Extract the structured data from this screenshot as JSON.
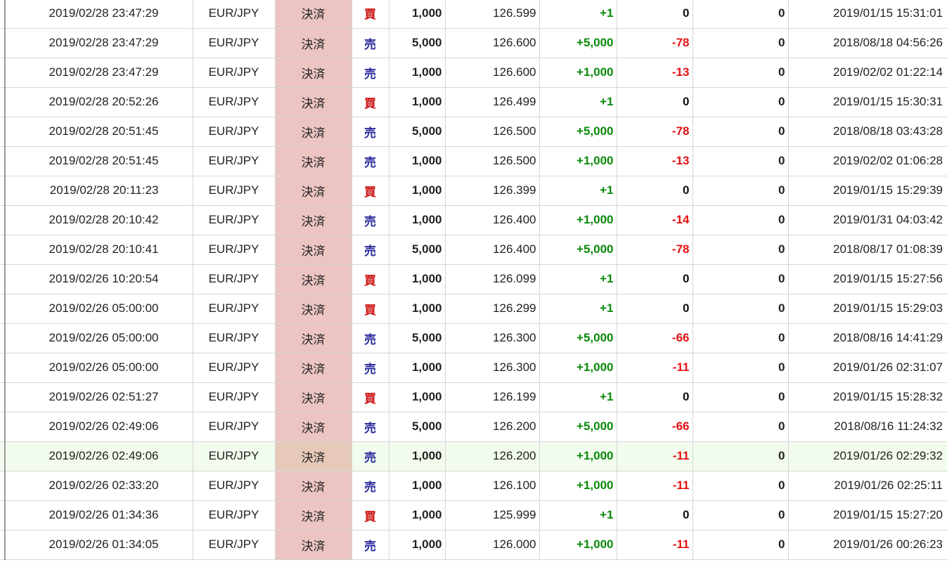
{
  "colors": {
    "buy": "#cc1111",
    "sell": "#2b2b9c",
    "positive": "#0a8a0a",
    "negative": "#e31010",
    "neutral": "#111111",
    "type_bg": "#ecc5c3",
    "highlight_row": "#f1fbee"
  },
  "rows": [
    {
      "time": "2019/02/28 23:47:29",
      "pair": "EUR/JPY",
      "type": "決済",
      "side": "買",
      "side_key": "buy",
      "qty": "1,000",
      "price": "126.599",
      "pnl": "+1",
      "swap": "0",
      "fee": "0",
      "open_time": "2019/01/15 15:31:01"
    },
    {
      "time": "2019/02/28 23:47:29",
      "pair": "EUR/JPY",
      "type": "決済",
      "side": "売",
      "side_key": "sell",
      "qty": "5,000",
      "price": "126.600",
      "pnl": "+5,000",
      "swap": "-78",
      "fee": "0",
      "open_time": "2018/08/18 04:56:26"
    },
    {
      "time": "2019/02/28 23:47:29",
      "pair": "EUR/JPY",
      "type": "決済",
      "side": "売",
      "side_key": "sell",
      "qty": "1,000",
      "price": "126.600",
      "pnl": "+1,000",
      "swap": "-13",
      "fee": "0",
      "open_time": "2019/02/02 01:22:14"
    },
    {
      "time": "2019/02/28 20:52:26",
      "pair": "EUR/JPY",
      "type": "決済",
      "side": "買",
      "side_key": "buy",
      "qty": "1,000",
      "price": "126.499",
      "pnl": "+1",
      "swap": "0",
      "fee": "0",
      "open_time": "2019/01/15 15:30:31"
    },
    {
      "time": "2019/02/28 20:51:45",
      "pair": "EUR/JPY",
      "type": "決済",
      "side": "売",
      "side_key": "sell",
      "qty": "5,000",
      "price": "126.500",
      "pnl": "+5,000",
      "swap": "-78",
      "fee": "0",
      "open_time": "2018/08/18 03:43:28"
    },
    {
      "time": "2019/02/28 20:51:45",
      "pair": "EUR/JPY",
      "type": "決済",
      "side": "売",
      "side_key": "sell",
      "qty": "1,000",
      "price": "126.500",
      "pnl": "+1,000",
      "swap": "-13",
      "fee": "0",
      "open_time": "2019/02/02 01:06:28"
    },
    {
      "time": "2019/02/28 20:11:23",
      "pair": "EUR/JPY",
      "type": "決済",
      "side": "買",
      "side_key": "buy",
      "qty": "1,000",
      "price": "126.399",
      "pnl": "+1",
      "swap": "0",
      "fee": "0",
      "open_time": "2019/01/15 15:29:39"
    },
    {
      "time": "2019/02/28 20:10:42",
      "pair": "EUR/JPY",
      "type": "決済",
      "side": "売",
      "side_key": "sell",
      "qty": "1,000",
      "price": "126.400",
      "pnl": "+1,000",
      "swap": "-14",
      "fee": "0",
      "open_time": "2019/01/31 04:03:42"
    },
    {
      "time": "2019/02/28 20:10:41",
      "pair": "EUR/JPY",
      "type": "決済",
      "side": "売",
      "side_key": "sell",
      "qty": "5,000",
      "price": "126.400",
      "pnl": "+5,000",
      "swap": "-78",
      "fee": "0",
      "open_time": "2018/08/17 01:08:39"
    },
    {
      "time": "2019/02/26 10:20:54",
      "pair": "EUR/JPY",
      "type": "決済",
      "side": "買",
      "side_key": "buy",
      "qty": "1,000",
      "price": "126.099",
      "pnl": "+1",
      "swap": "0",
      "fee": "0",
      "open_time": "2019/01/15 15:27:56"
    },
    {
      "time": "2019/02/26 05:00:00",
      "pair": "EUR/JPY",
      "type": "決済",
      "side": "買",
      "side_key": "buy",
      "qty": "1,000",
      "price": "126.299",
      "pnl": "+1",
      "swap": "0",
      "fee": "0",
      "open_time": "2019/01/15 15:29:03"
    },
    {
      "time": "2019/02/26 05:00:00",
      "pair": "EUR/JPY",
      "type": "決済",
      "side": "売",
      "side_key": "sell",
      "qty": "5,000",
      "price": "126.300",
      "pnl": "+5,000",
      "swap": "-66",
      "fee": "0",
      "open_time": "2018/08/16 14:41:29"
    },
    {
      "time": "2019/02/26 05:00:00",
      "pair": "EUR/JPY",
      "type": "決済",
      "side": "売",
      "side_key": "sell",
      "qty": "1,000",
      "price": "126.300",
      "pnl": "+1,000",
      "swap": "-11",
      "fee": "0",
      "open_time": "2019/01/26 02:31:07"
    },
    {
      "time": "2019/02/26 02:51:27",
      "pair": "EUR/JPY",
      "type": "決済",
      "side": "買",
      "side_key": "buy",
      "qty": "1,000",
      "price": "126.199",
      "pnl": "+1",
      "swap": "0",
      "fee": "0",
      "open_time": "2019/01/15 15:28:32"
    },
    {
      "time": "2019/02/26 02:49:06",
      "pair": "EUR/JPY",
      "type": "決済",
      "side": "売",
      "side_key": "sell",
      "qty": "5,000",
      "price": "126.200",
      "pnl": "+5,000",
      "swap": "-66",
      "fee": "0",
      "open_time": "2018/08/16 11:24:32"
    },
    {
      "time": "2019/02/26 02:49:06",
      "pair": "EUR/JPY",
      "type": "決済",
      "side": "売",
      "side_key": "sell",
      "qty": "1,000",
      "price": "126.200",
      "pnl": "+1,000",
      "swap": "-11",
      "fee": "0",
      "open_time": "2019/01/26 02:29:32",
      "highlight": true
    },
    {
      "time": "2019/02/26 02:33:20",
      "pair": "EUR/JPY",
      "type": "決済",
      "side": "売",
      "side_key": "sell",
      "qty": "1,000",
      "price": "126.100",
      "pnl": "+1,000",
      "swap": "-11",
      "fee": "0",
      "open_time": "2019/01/26 02:25:11"
    },
    {
      "time": "2019/02/26 01:34:36",
      "pair": "EUR/JPY",
      "type": "決済",
      "side": "買",
      "side_key": "buy",
      "qty": "1,000",
      "price": "125.999",
      "pnl": "+1",
      "swap": "0",
      "fee": "0",
      "open_time": "2019/01/15 15:27:20"
    },
    {
      "time": "2019/02/26 01:34:05",
      "pair": "EUR/JPY",
      "type": "決済",
      "side": "売",
      "side_key": "sell",
      "qty": "1,000",
      "price": "126.000",
      "pnl": "+1,000",
      "swap": "-11",
      "fee": "0",
      "open_time": "2019/01/26 00:26:23"
    }
  ]
}
